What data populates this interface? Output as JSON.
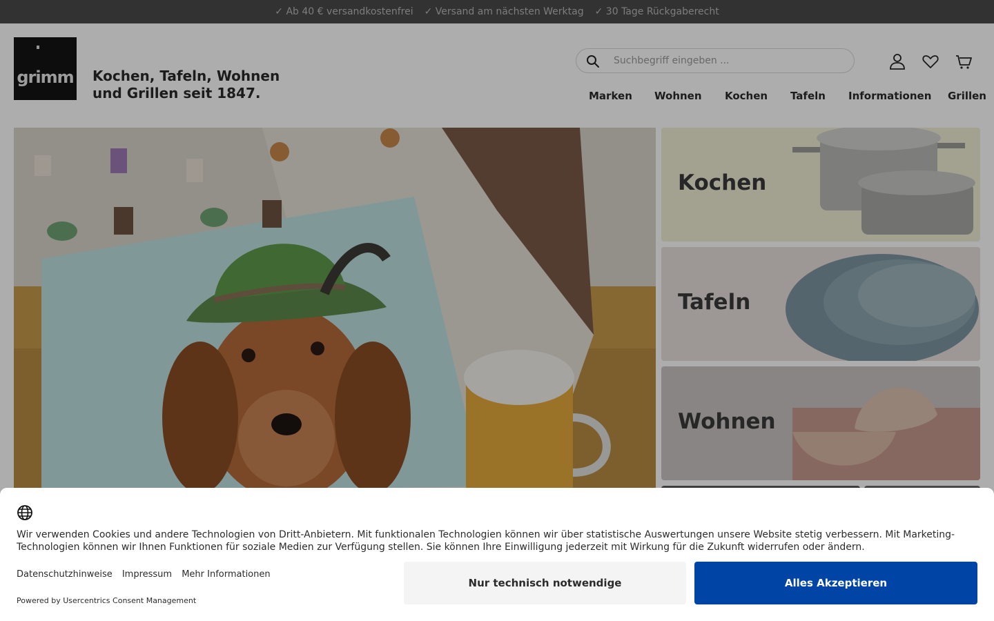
{
  "topbar": {
    "items": [
      "✓ Ab 40 € versandkostenfrei",
      "✓ Versand am nächsten Werktag",
      "✓ 30 Tage Rückgaberecht"
    ]
  },
  "header": {
    "logo_text": "grimm",
    "tagline": "Kochen, Tafeln, Wohnen und Grillen seit 1847.",
    "search_placeholder": "Suchbegriff eingeben ...",
    "nav": [
      "Marken",
      "Wohnen",
      "Kochen",
      "Tafeln",
      "Informationen",
      "Grillen"
    ]
  },
  "categories": [
    {
      "label": "Kochen",
      "color": "#f0eed5"
    },
    {
      "label": "Tafeln",
      "color": "#e8e1de"
    },
    {
      "label": "Wohnen",
      "color": "#c9c4c3"
    }
  ],
  "cookie": {
    "text": "Wir verwenden Cookies und andere Technologien von Dritt-Anbietern. Mit funktionalen Technologien können wir über statistische Auswertungen unsere Website stetig verbessern. Mit Marketing-Technologien können wir Ihnen Funktionen für soziale Medien zur Verfügung stellen. Sie können Ihre Einwilligung jederzeit mit Wirkung für die Zukunft widerrufen oder ändern.",
    "links": [
      "Datenschutzhinweise",
      "Impressum",
      "Mehr Informationen"
    ],
    "powered": "Powered by Usercentrics Consent Management",
    "btn_necessary": "Nur technisch notwendige",
    "btn_accept": "Alles Akzeptieren"
  },
  "colors": {
    "accent": "#0045a5",
    "topbar_bg": "#4a4a4a"
  }
}
